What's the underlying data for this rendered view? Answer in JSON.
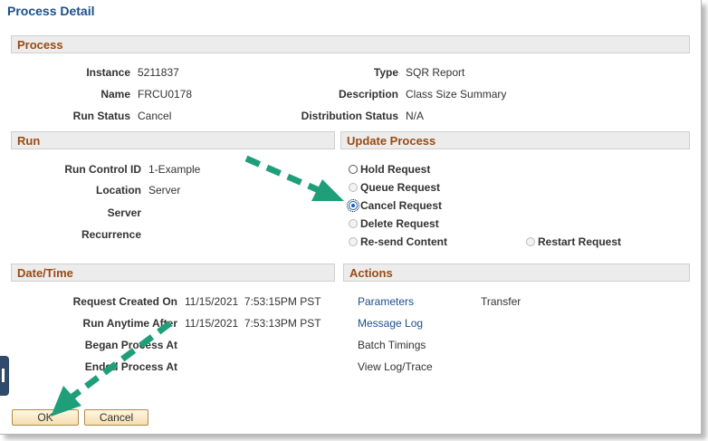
{
  "page_title": "Process Detail",
  "colors": {
    "title": "#1c4f8a",
    "section_header_text": "#9a4a12",
    "arrow": "#1f9e7a",
    "link": "#1c4f8a"
  },
  "process": {
    "header": "Process",
    "instance_label": "Instance",
    "instance_value": "5211837",
    "name_label": "Name",
    "name_value": "FRCU0178",
    "run_status_label": "Run Status",
    "run_status_value": "Cancel",
    "type_label": "Type",
    "type_value": "SQR Report",
    "description_label": "Description",
    "description_value": "Class Size Summary",
    "distribution_status_label": "Distribution Status",
    "distribution_status_value": "N/A"
  },
  "run": {
    "header": "Run",
    "run_control_id_label": "Run Control ID",
    "run_control_id_value": "1-Example",
    "location_label": "Location",
    "location_value": "Server",
    "server_label": "Server",
    "recurrence_label": "Recurrence"
  },
  "update_process": {
    "header": "Update Process",
    "hold": "Hold Request",
    "queue": "Queue Request",
    "cancel": "Cancel Request",
    "delete": "Delete Request",
    "resend": "Re-send Content",
    "restart": "Restart Request",
    "selected": "Cancel Request"
  },
  "datetime": {
    "header": "Date/Time",
    "request_created_label": "Request Created On",
    "request_created_value": "11/15/2021  7:53:15PM PST",
    "run_anytime_after_label": "Run Anytime After",
    "run_anytime_after_value": "11/15/2021  7:53:13PM PST",
    "began_label": "Began Process At",
    "ended_label": "Ended Process At"
  },
  "actions": {
    "header": "Actions",
    "parameters": "Parameters",
    "transfer": "Transfer",
    "message_log": "Message Log",
    "batch_timings": "Batch Timings",
    "view_log": "View Log/Trace"
  },
  "buttons": {
    "ok": "OK",
    "cancel": "Cancel"
  },
  "icons": {
    "arrow_1": "dashed-arrow-icon",
    "arrow_2": "dashed-arrow-icon"
  }
}
